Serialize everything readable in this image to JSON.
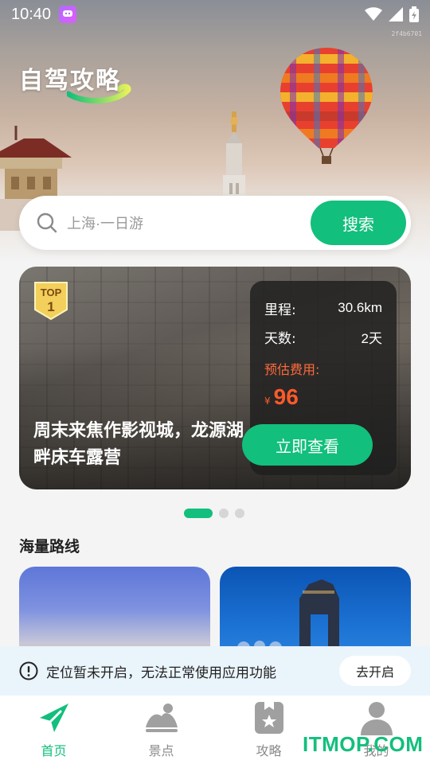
{
  "status_bar": {
    "time": "10:40",
    "app_badge_icon": "chat-bubble-icon",
    "icons": [
      "wifi-icon",
      "signal-icon",
      "battery-icon"
    ]
  },
  "hero": {
    "corner_code": "2f4b6701",
    "title": "自驾攻略"
  },
  "search": {
    "placeholder": "上海·一日游",
    "button_label": "搜索"
  },
  "featured_route": {
    "badge_top": "TOP",
    "badge_rank": "1",
    "title": "周末来焦作影视城，龙源湖畔床车露营",
    "mileage_label": "里程:",
    "mileage_value": "30.6km",
    "days_label": "天数:",
    "days_value": "2天",
    "cost_label": "预估费用:",
    "currency_symbol": "¥",
    "cost_value": "96",
    "view_button_label": "立即查看"
  },
  "carousel": {
    "count": 3,
    "active_index": 0
  },
  "routes_section": {
    "title": "海量路线"
  },
  "location_notice": {
    "text": "定位暂未开启，无法正常使用应用功能",
    "button_label": "去开启"
  },
  "tab_bar": {
    "tabs": [
      {
        "label": "首页",
        "icon": "paper-plane-icon",
        "active": true
      },
      {
        "label": "景点",
        "icon": "scenic-icon",
        "active": false
      },
      {
        "label": "攻略",
        "icon": "bookmark-star-icon",
        "active": false
      },
      {
        "label": "我的",
        "icon": "person-icon",
        "active": false
      }
    ]
  },
  "watermark": "ITMOP.COM",
  "colors": {
    "accent": "#12bf7c",
    "price": "#ff5a2a",
    "notice_bg": "#eaf4fb"
  }
}
